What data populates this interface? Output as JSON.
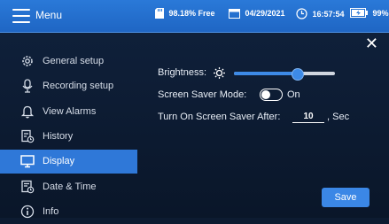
{
  "header": {
    "menu_label": "Menu",
    "storage": "98.18% Free",
    "date": "04/29/2021",
    "time": "16:57:54",
    "battery": "99%"
  },
  "sidebar": {
    "items": [
      {
        "label": "General setup",
        "icon": "gear-icon"
      },
      {
        "label": "Recording setup",
        "icon": "microphone-icon"
      },
      {
        "label": "View Alarms",
        "icon": "bell-icon"
      },
      {
        "label": "History",
        "icon": "history-icon"
      },
      {
        "label": "Display",
        "icon": "monitor-icon",
        "active": true
      },
      {
        "label": "Date & Time",
        "icon": "calendar-clock-icon"
      },
      {
        "label": "Info",
        "icon": "info-icon"
      }
    ]
  },
  "display_settings": {
    "brightness_label": "Brightness:",
    "brightness_level": 0.62,
    "screen_saver_label": "Screen Saver Mode:",
    "screen_saver_state": "On",
    "delay_label": "Turn On Screen Saver After:",
    "delay_value": "10",
    "delay_unit": ", Sec"
  },
  "actions": {
    "close": "✕",
    "save_label": "Save"
  },
  "colors": {
    "accent": "#2f78d8",
    "topbar": "#2a79d8",
    "background": "#0d1b31"
  }
}
